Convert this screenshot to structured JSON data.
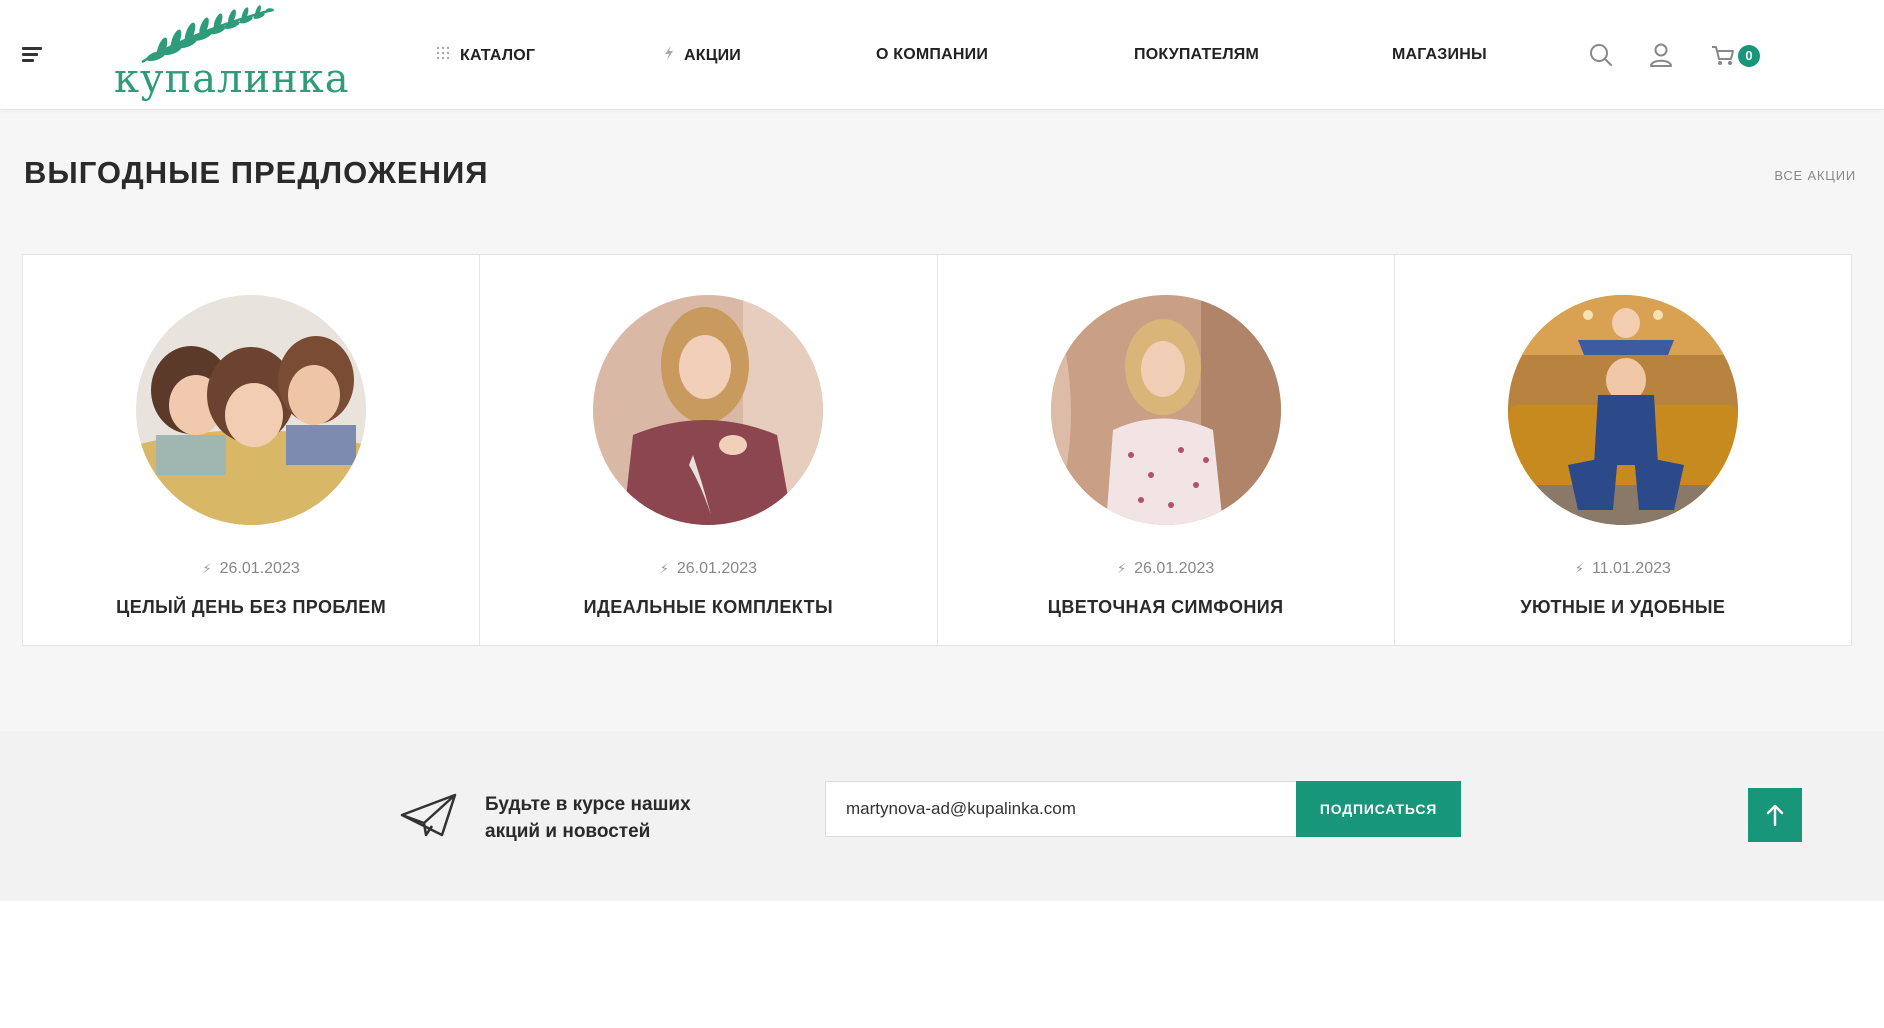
{
  "header": {
    "logo_text": "купалинка",
    "nav": [
      {
        "label": "КАТАЛОГ",
        "icon": "grid-dots-icon"
      },
      {
        "label": "АКЦИИ",
        "icon": "lightning-icon"
      },
      {
        "label": "О КОМПАНИИ"
      },
      {
        "label": "ПОКУПАТЕЛЯМ"
      },
      {
        "label": "МАГАЗИНЫ"
      }
    ],
    "cart_count": "0"
  },
  "offers": {
    "title": "ВЫГОДНЫЕ ПРЕДЛОЖЕНИЯ",
    "all_link": "ВСЕ АКЦИИ",
    "items": [
      {
        "date": "26.01.2023",
        "title": "ЦЕЛЫЙ ДЕНЬ БЕЗ ПРОБЛЕМ"
      },
      {
        "date": "26.01.2023",
        "title": "ИДЕАЛЬНЫЕ КОМПЛЕКТЫ"
      },
      {
        "date": "26.01.2023",
        "title": "ЦВЕТОЧНАЯ СИМФОНИЯ"
      },
      {
        "date": "11.01.2023",
        "title": "УЮТНЫЕ И УДОБНЫЕ"
      }
    ]
  },
  "subscribe": {
    "text": "Будьте в курсе наших акций и новостей",
    "email_value": "martynova-ad@kupalinka.com",
    "button_label": "ПОДПИСАТЬСЯ"
  },
  "colors": {
    "accent": "#17967a",
    "logo_green": "#2e9c7a",
    "section_bg": "#f6f6f6",
    "subscribe_bg": "#f2f2f2"
  }
}
